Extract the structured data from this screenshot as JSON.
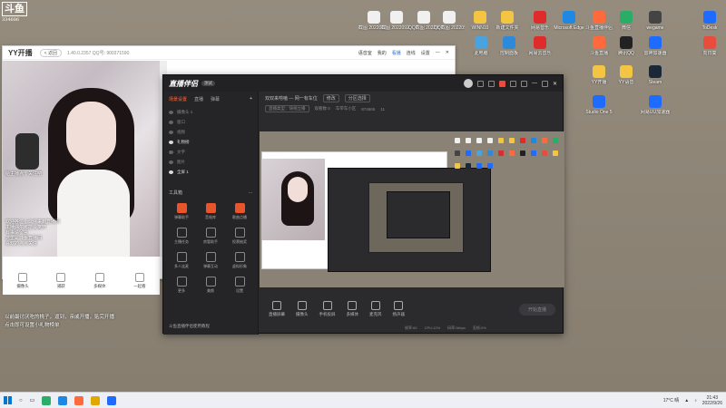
{
  "watermark": {
    "logo": "斗鱼",
    "room": "334686"
  },
  "desktop_icons": [
    {
      "label": "截图\n2022092...",
      "color": "#f0f0f0"
    },
    {
      "label": "截图\n2022092...",
      "color": "#f0f0f0"
    },
    {
      "label": "QQ截图\n2022092...",
      "color": "#f0f0f0"
    },
    {
      "label": "QQ截图\n2022092...",
      "color": "#f0f0f0"
    },
    {
      "label": "WINN10",
      "color": "#f4c542"
    },
    {
      "label": "新建文件夹",
      "color": "#f4c542"
    },
    {
      "label": "网易音乐",
      "color": "#e02b2b"
    },
    {
      "label": "Microsoft Edge",
      "color": "#1e88e5"
    },
    {
      "label": "斗鱼直播伴侣",
      "color": "#ff6a3c"
    },
    {
      "label": "微信",
      "color": "#2aae67"
    },
    {
      "label": "wegame",
      "color": "#444444"
    },
    {
      "label": "ToDesk",
      "color": "#1e6bff"
    },
    {
      "label": "此电脑",
      "color": "#4aa3df"
    },
    {
      "label": "控制面板",
      "color": "#2c8ad8"
    },
    {
      "label": "网易云音乐",
      "color": "#e02b2b"
    },
    {
      "label": "斗鱼直播",
      "color": "#ff6a3c"
    },
    {
      "label": "腾讯QQ",
      "color": "#222222"
    },
    {
      "label": "雷神加速器",
      "color": "#1e6bff"
    },
    {
      "label": "向日葵",
      "color": "#e74c3c"
    },
    {
      "label": "YY开播",
      "color": "#f4c542"
    },
    {
      "label": "YY语音",
      "color": "#f4c542"
    },
    {
      "label": "Steam",
      "color": "#1b2838"
    },
    {
      "label": "Studio One 5",
      "color": "#1e6bff"
    },
    {
      "label": "网易UU加速器",
      "color": "#1e6bff"
    }
  ],
  "yy_window": {
    "title": "YY开播",
    "back": "< 返回",
    "meta": "1.40.0.2357  QQ号: 900371590",
    "right": [
      "我的",
      "看播",
      "连线",
      "设置"
    ],
    "right_label": "语音室",
    "overlay_top": "给主播点个关注吧",
    "overlay_lines": [
      "欢迎各位小伙伴来到直播间",
      "主播偶尔可能会离开",
      "有事请留言",
      "这里是斗鱼直播间",
      "喜欢的点点关注"
    ],
    "tools": [
      "摄像头",
      "捕获",
      "多媒体",
      "一起看"
    ]
  },
  "app": {
    "title": "直播伴侣",
    "badge": "测试",
    "tabs": [
      "场景设置",
      "直播",
      "弹幕"
    ],
    "add_symbol": "+",
    "scenes": [
      {
        "label": "摄像头 1",
        "on": false
      },
      {
        "label": "窗口",
        "on": false
      },
      {
        "label": "视频",
        "on": false
      },
      {
        "label": "礼物榜",
        "on": true
      },
      {
        "label": "文字",
        "on": false
      },
      {
        "label": "图片",
        "on": false
      },
      {
        "label": "全屏 1",
        "on": true
      }
    ],
    "toolbox_title": "工具箱",
    "toolbox_more": "...",
    "tools": [
      {
        "label": "弹幕助手",
        "orange": true
      },
      {
        "label": "音效库",
        "orange": true
      },
      {
        "label": "歌曲点播",
        "orange": true
      },
      {
        "label": "主播任务",
        "orange": false
      },
      {
        "label": "房管助手",
        "orange": false
      },
      {
        "label": "投票抽奖",
        "orange": false
      },
      {
        "label": "多人连麦",
        "orange": false
      },
      {
        "label": "弹幕互动",
        "orange": false
      },
      {
        "label": "虚拟形象",
        "orange": false
      },
      {
        "label": "更多",
        "orange": false
      },
      {
        "label": "美颜",
        "orange": false
      },
      {
        "label": "设置",
        "orange": false
      }
    ],
    "footer": "斗鱼直播伴侣使用教程",
    "room_title": "双双来唠嗑 — 网一有车位",
    "edit_label": "修改",
    "category_label": "分区选择",
    "live_type": "直播类型：快视立播",
    "viewers": "观看数 0",
    "fans_label": "车带车小区",
    "fans_count": "874665",
    "level": "11",
    "bottom": [
      "直播屏幕",
      "摄像头",
      "手机投屏",
      "多媒体",
      "麦克风",
      "扬声器"
    ],
    "start_button": "开始直播",
    "stats": [
      "帧率:60",
      "CPU:12%",
      "码率:0kbps",
      "丢帧:0%"
    ]
  },
  "subtitles": [
    "以前最讨厌吃的桃子，逼到，亲戚开播，贴完开播",
    "点击即可设置小礼物榜单"
  ],
  "taskbar": {
    "weather": "17°C 晴",
    "time": "21:43",
    "date": "2022/9/26",
    "apps": [
      "#2aae67",
      "#1e88e5",
      "#ff6a3c",
      "#e0a800",
      "#1e6bff"
    ]
  }
}
